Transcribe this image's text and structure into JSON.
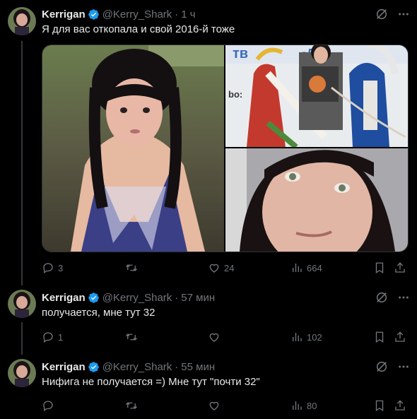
{
  "tweets": [
    {
      "name": "Kerrigan",
      "handle": "@Kerry_Shark",
      "separator": "·",
      "time": "1 ч",
      "text": "Я для вас откопала и свой 2016-й тоже",
      "replies": "3",
      "retweets": "",
      "likes": "24",
      "views": "664"
    },
    {
      "name": "Kerrigan",
      "handle": "@Kerry_Shark",
      "separator": "·",
      "time": "57 мин",
      "text": "получается, мне тут 32",
      "replies": "1",
      "retweets": "",
      "likes": "",
      "views": "102"
    },
    {
      "name": "Kerrigan",
      "handle": "@Kerry_Shark",
      "separator": "·",
      "time": "55 мин",
      "text": "Нифига не получается =) Мне тут \"почти 32\"",
      "replies": "",
      "retweets": "",
      "likes": "",
      "views": "80"
    }
  ],
  "media_partial_text": [
    "тв",
    "-дэ",
    "bo:"
  ],
  "colors": {
    "background": "#000000",
    "text_primary": "#e7e9ea",
    "text_secondary": "#71767b",
    "verified": "#1d9bf0",
    "thread_line": "#333639"
  },
  "icons": [
    "verified-badge-icon",
    "grok-icon",
    "more-icon",
    "reply-icon",
    "retweet-icon",
    "like-icon",
    "views-icon",
    "bookmark-icon",
    "share-icon"
  ]
}
